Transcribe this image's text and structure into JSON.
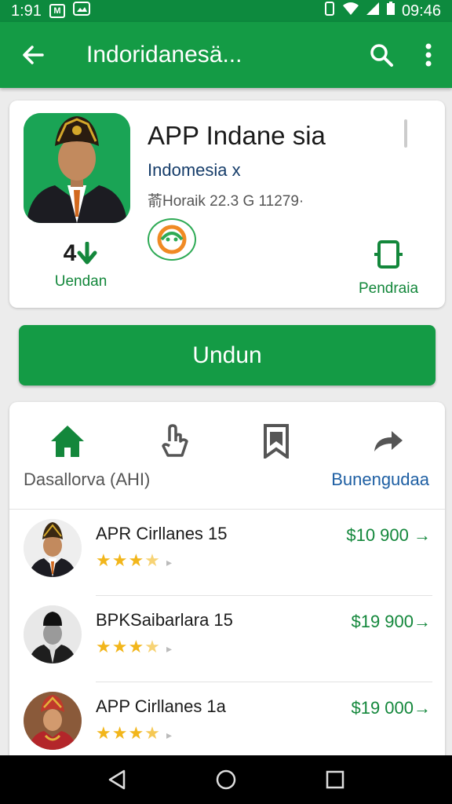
{
  "status": {
    "time": "1:91",
    "notif1": "M",
    "clock": "09:46"
  },
  "app_bar": {
    "title": "Indoridanesä...",
    "icons": [
      "back-arrow-icon",
      "search-icon",
      "more-vert-icon"
    ]
  },
  "app": {
    "name": "APP Indane sia",
    "subtitle": "Indomesia x",
    "meta": "萮Horaik 22.3 G 11279·",
    "rating_value": "4",
    "rating_label": "Uendan",
    "action_label": "Pendraia"
  },
  "install_button": "Undun",
  "tabs": {
    "left_label": "Dasallorva (AHI)",
    "right_label": "Bunengudaa",
    "icons": [
      "home-icon",
      "share-icon",
      "bookmark-icon",
      "forward-icon"
    ]
  },
  "list": [
    {
      "title": "APR Cirllanes 15",
      "price": "$10 900 →",
      "rating": 3.5
    },
    {
      "title": "BPKSaibarlara 15",
      "price": "$19 900→",
      "rating": 3.5
    },
    {
      "title": "APP Cirllanes 1a",
      "price": "$19 000→",
      "rating": 3.8
    }
  ],
  "colors": {
    "primary_green": "#149b45",
    "status_green": "#0d8a3e",
    "link_blue": "#1e5fa3",
    "star_yellow": "#f2b61b"
  }
}
